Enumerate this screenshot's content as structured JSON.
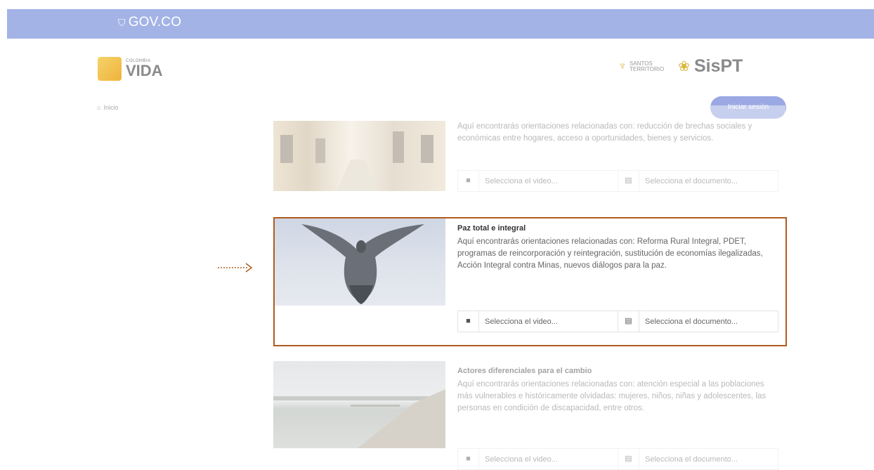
{
  "govbar": {
    "brand": "GOV.CO"
  },
  "header": {
    "logo_left": {
      "small": "COLOMBIA",
      "big": "VIDA"
    },
    "logo_right_a": {
      "line1": "SANTOS",
      "line2": "TERRITORIO"
    },
    "logo_right_b": "SisPT",
    "breadcrumb": "Inicio",
    "login_label": "Iniciar sesión"
  },
  "cards": [
    {
      "title": "",
      "description": "Aquí encontrarás orientaciones relacionadas con: reducción de brechas sociales y económicas entre hogares, acceso a oportunidades, bienes y servicios.",
      "video_label": "Selecciona el video...",
      "doc_label": "Selecciona el documento..."
    },
    {
      "title": "Paz total e integral",
      "description": "Aquí encontrarás orientaciones relacionadas con: Reforma Rural Integral, PDET, programas de reincorporación y reintegración, sustitución de economías ilegalizadas, Acción Integral contra Minas, nuevos diálogos para la paz.",
      "video_label": "Selecciona el video...",
      "doc_label": "Selecciona el documento..."
    },
    {
      "title": "Actores diferenciales para el cambio",
      "description": "Aquí encontrarás orientaciones relacionadas con: atención especial a las poblaciones más vulnerables e históricamente olvidadas: mujeres, niños, niñas y adolescentes, las personas en condición de discapacidad, entre otros.",
      "video_label": "Selecciona el video...",
      "doc_label": "Selecciona el documento..."
    }
  ],
  "icons": {
    "video": "video-icon",
    "document": "document-icon"
  },
  "colors": {
    "govbar": "#a3b3e6",
    "login": "#9aa9e3",
    "highlight": "#b05b1e"
  }
}
